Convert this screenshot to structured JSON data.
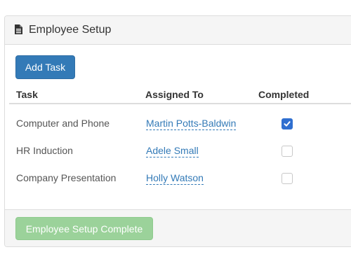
{
  "panel": {
    "title": "Employee Setup",
    "title_icon": "document-icon"
  },
  "toolbar": {
    "add_task_label": "Add Task"
  },
  "table": {
    "headers": [
      "Task",
      "Assigned To",
      "Completed"
    ],
    "rows": [
      {
        "task": "Computer and Phone",
        "assigned_to": "Martin Potts-Baldwin",
        "completed": true
      },
      {
        "task": "HR Induction",
        "assigned_to": "Adele Small",
        "completed": false
      },
      {
        "task": "Company Presentation",
        "assigned_to": "Holly Watson",
        "completed": false
      }
    ]
  },
  "footer": {
    "complete_label": "Employee Setup Complete",
    "complete_enabled": false
  },
  "colors": {
    "primary": "#337ab7",
    "success_disabled": "#9bd29a",
    "checkbox_checked": "#2f6fd0",
    "panel_bg": "#f5f5f5"
  }
}
